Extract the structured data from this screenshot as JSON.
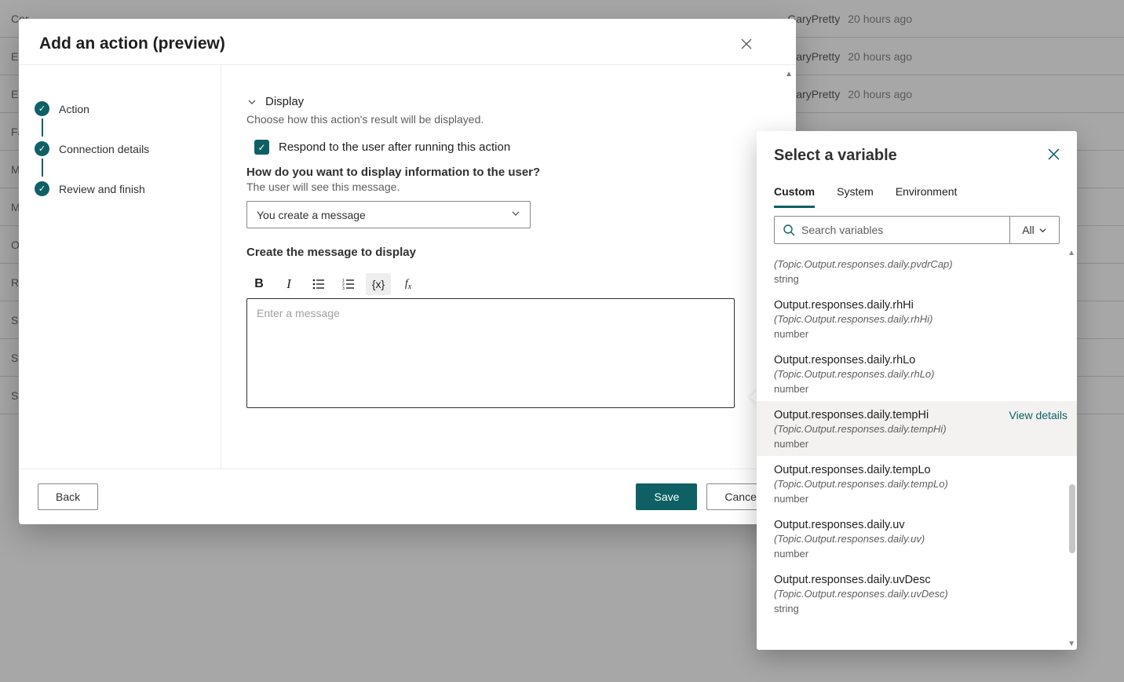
{
  "modal": {
    "title": "Add an action (preview)",
    "steps": [
      "Action",
      "Connection details",
      "Review and finish"
    ],
    "display": {
      "section_label": "Display",
      "description": "Choose how this action's result will be displayed.",
      "respond_checkbox": "Respond to the user after running this action",
      "how_heading": "How do you want to display information to the user?",
      "how_sub": "The user will see this message.",
      "select_value": "You create a message",
      "create_label": "Create the message to display",
      "placeholder": "Enter a message"
    },
    "toolbar": {
      "bold": "B",
      "italic": "I",
      "var": "{x}",
      "fx": "fx"
    },
    "buttons": {
      "back": "Back",
      "save": "Save",
      "cancel": "Cancel"
    }
  },
  "popover": {
    "title": "Select a variable",
    "tabs": [
      "Custom",
      "System",
      "Environment"
    ],
    "search_placeholder": "Search variables",
    "filter_label": "All",
    "view_details": "View details",
    "vars": [
      {
        "name_sub": "(Topic.Output.responses.daily.pvdrCap)",
        "type": "string",
        "partial": true
      },
      {
        "name": "Output.responses.daily.rhHi",
        "name_sub": "(Topic.Output.responses.daily.rhHi)",
        "type": "number"
      },
      {
        "name": "Output.responses.daily.rhLo",
        "name_sub": "(Topic.Output.responses.daily.rhLo)",
        "type": "number"
      },
      {
        "name": "Output.responses.daily.tempHi",
        "name_sub": "(Topic.Output.responses.daily.tempHi)",
        "type": "number",
        "hover": true
      },
      {
        "name": "Output.responses.daily.tempLo",
        "name_sub": "(Topic.Output.responses.daily.tempLo)",
        "type": "number"
      },
      {
        "name": "Output.responses.daily.uv",
        "name_sub": "(Topic.Output.responses.daily.uv)",
        "type": "number"
      },
      {
        "name": "Output.responses.daily.uvDesc",
        "name_sub": "(Topic.Output.responses.daily.uvDesc)",
        "type": "string"
      }
    ]
  },
  "background": {
    "rows": [
      "Cor",
      "End",
      "Esc",
      "Fal",
      "MS",
      "Mu",
      "On",
      "Res",
      "Sig",
      "Sto",
      "Sto"
    ],
    "meta": [
      {
        "user": "GaryPretty",
        "time": "20 hours ago"
      },
      {
        "user": "GaryPretty",
        "time": "20 hours ago"
      },
      {
        "user": "GaryPretty",
        "time": "20 hours ago"
      }
    ]
  }
}
